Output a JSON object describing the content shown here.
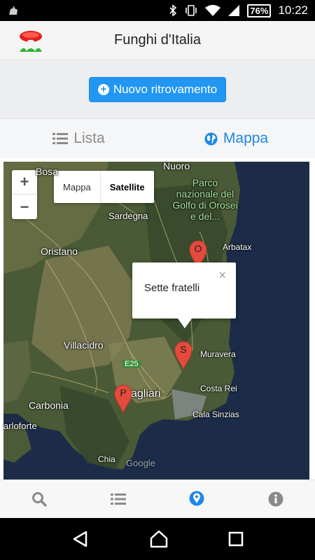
{
  "status_bar": {
    "time": "10:22",
    "battery": "76%"
  },
  "app": {
    "title": "Funghi d'Italia"
  },
  "actions": {
    "new_button_label": "Nuovo ritrovamento"
  },
  "tabs": [
    {
      "label": "Lista",
      "active": false
    },
    {
      "label": "Mappa",
      "active": true
    }
  ],
  "map": {
    "zoom_in": "+",
    "zoom_out": "−",
    "type_map": "Mappa",
    "type_satellite": "Satellite",
    "park_label": "Parco nazionale del Golfo di Orosei e del...",
    "places": {
      "nuoro": "Nuoro",
      "bosa": "Bosa",
      "sardegna": "Sardegna",
      "oristano": "Oristano",
      "arbatax": "Arbatax",
      "villacidro": "Villacidro",
      "muravera": "Muravera",
      "road": "E25",
      "cagliari": "agliari",
      "carbonia": "Carbonia",
      "costa_rei": "Costa Rei",
      "cala_sinzias": "Cala Sinzias",
      "carloforte": "arloforte",
      "chia": "Chia",
      "google": "Google"
    },
    "markers": [
      {
        "letter": "O"
      },
      {
        "letter": "S"
      },
      {
        "letter": "P"
      }
    ],
    "info_window": {
      "text": "Sette fratelli",
      "close": "×"
    }
  },
  "colors": {
    "primary": "#2196f3",
    "active_tab": "#1e88e5",
    "marker": "#e64a3c"
  }
}
